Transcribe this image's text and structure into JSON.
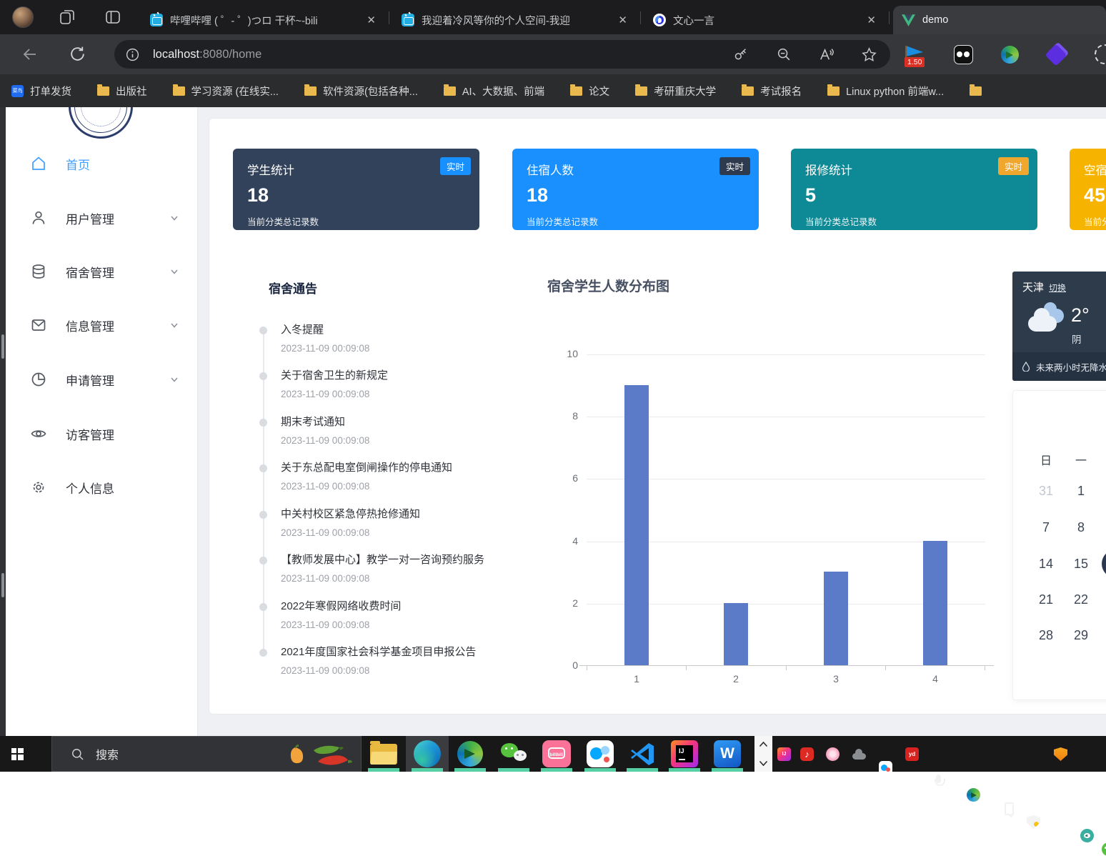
{
  "colors": {
    "accent_blue": "#409eff",
    "bar_blue": "#5b7bc8",
    "indicator_green": "#57cfa4",
    "badge_red": "#d93025"
  },
  "icons": {
    "close": "✕",
    "scroll_up": "⌃",
    "scroll_down": "⌄"
  },
  "browser": {
    "tabs": [
      {
        "icon": "bilibili-icon",
        "title": "哔哩哔哩 ( ゜- ゜)つロ 干杯~-bili"
      },
      {
        "icon": "bilibili-icon",
        "title": "我迎着冷风等你的个人空间-我迎"
      },
      {
        "icon": "yiyan-icon",
        "title": "文心一言"
      },
      {
        "icon": "vue-icon",
        "title": "demo",
        "active": true
      }
    ],
    "toolbar": {
      "url_host": "localhost",
      "url_rest": ":8080/home",
      "speed_badge": "1.50"
    },
    "bookmarks": [
      {
        "icon": "cainiao-icon",
        "icon_text": "菜鸟",
        "label": "打单发货"
      },
      {
        "icon": "folder-icon",
        "label": "出版社"
      },
      {
        "icon": "folder-icon",
        "label": "学习资源 (在线实..."
      },
      {
        "icon": "folder-icon",
        "label": "软件资源(包括各种..."
      },
      {
        "icon": "folder-icon",
        "label": "AI、大数据、前端"
      },
      {
        "icon": "folder-icon",
        "label": "论文"
      },
      {
        "icon": "folder-icon",
        "label": "考研重庆大学"
      },
      {
        "icon": "folder-icon",
        "label": "考试报名"
      },
      {
        "icon": "folder-icon",
        "label": "Linux python 前端w..."
      },
      {
        "icon": "folder-icon",
        "label": ""
      }
    ]
  },
  "sidebar": {
    "items": [
      {
        "label": "首页",
        "icon": "home-icon",
        "active": true
      },
      {
        "label": "用户管理",
        "icon": "user-icon",
        "chevron": true
      },
      {
        "label": "宿舍管理",
        "icon": "database-icon",
        "chevron": true
      },
      {
        "label": "信息管理",
        "icon": "mail-icon",
        "chevron": true
      },
      {
        "label": "申请管理",
        "icon": "pie-icon",
        "chevron": true
      },
      {
        "label": "访客管理",
        "icon": "eye-icon"
      },
      {
        "label": "个人信息",
        "icon": "gear-icon"
      }
    ]
  },
  "main": {
    "cards": [
      {
        "title": "学生统计",
        "badge": "实时",
        "value": "18",
        "subtitle": "当前分类总记录数",
        "bg": "#33425b",
        "badge_bg": "#1890ff"
      },
      {
        "title": "住宿人数",
        "badge": "实时",
        "value": "18",
        "subtitle": "当前分类总记录数",
        "bg": "#1a90ff",
        "badge_bg": "#2e3a4e"
      },
      {
        "title": "报修统计",
        "badge": "实时",
        "value": "5",
        "subtitle": "当前分类总记录数",
        "bg": "#0e8a96",
        "badge_bg": "#efa82d"
      },
      {
        "title": "空宿",
        "value": "45",
        "subtitle": "当前分",
        "bg": "#f6b400"
      }
    ],
    "notices": {
      "title": "宿舍通告",
      "items": [
        {
          "title": "入冬提醒",
          "time": "2023-11-09 00:09:08"
        },
        {
          "title": "关于宿舍卫生的新规定",
          "time": "2023-11-09 00:09:08"
        },
        {
          "title": "期末考试通知",
          "time": "2023-11-09 00:09:08"
        },
        {
          "title": "关于东总配电室倒闸操作的停电通知",
          "time": "2023-11-09 00:09:08"
        },
        {
          "title": "中关村校区紧急停热抢修通知",
          "time": "2023-11-09 00:09:08"
        },
        {
          "title": "【教师发展中心】教学一对一咨询预约服务",
          "time": "2023-11-09 00:09:08"
        },
        {
          "title": "2022年寒假网络收费时间",
          "time": "2023-11-09 00:09:08"
        },
        {
          "title": "2021年度国家社会科学基金项目申报公告",
          "time": "2023-11-09 00:09:08"
        }
      ]
    }
  },
  "chart_data": {
    "type": "bar",
    "title": "宿舍学生人数分布图",
    "categories": [
      "1",
      "2",
      "3",
      "4"
    ],
    "values": [
      9,
      2,
      3,
      4
    ],
    "xlabel": "",
    "ylabel": "",
    "ylim": [
      0,
      10
    ],
    "yticks": [
      0,
      2,
      4,
      6,
      8,
      10
    ],
    "grid": true,
    "legend": "none",
    "bar_color": "#5b7bc8"
  },
  "weather": {
    "city": "天津",
    "switch_label": "切换",
    "temp": "2°",
    "condition": "阴",
    "tip": "未来两小时无降水"
  },
  "calendar": {
    "day_headers": [
      "日",
      "一"
    ],
    "rows": [
      [
        "31",
        "1"
      ],
      [
        "7",
        "8"
      ],
      [
        "14",
        "15"
      ],
      [
        "21",
        "22"
      ],
      [
        "28",
        "29"
      ]
    ]
  },
  "taskbar": {
    "search_placeholder": "搜索",
    "bilibili_text": "bilibili",
    "intellij_text": "IJ",
    "word_text": "W",
    "youdao_text": "yd",
    "apps": [
      "file-explorer-icon",
      "edge-icon",
      "idm-icon",
      "wechat-icon",
      "bilibili-icon",
      "baidu-netdisk-icon",
      "vscode-icon",
      "intellij-icon",
      "word-icon"
    ],
    "tray": [
      "intellij-icon",
      "netease-music-icon",
      "flower-icon",
      "cloud-icon",
      "baidu-netdisk-icon",
      "youdao-icon",
      "microphone-icon",
      "idm-icon",
      "usb-icon",
      "defender-icon",
      "huorong-icon",
      "eye-icon",
      "wechat-icon"
    ]
  }
}
